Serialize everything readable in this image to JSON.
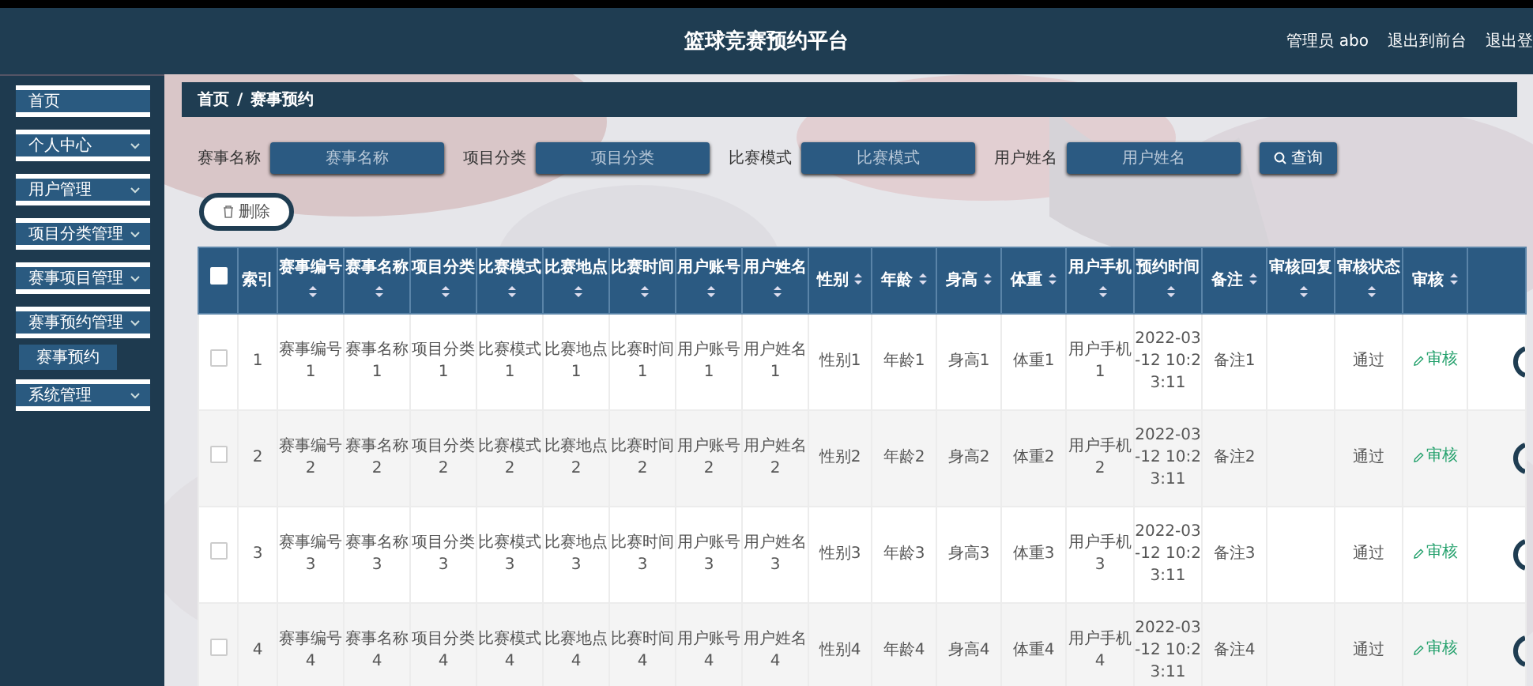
{
  "header": {
    "title": "篮球竞赛预约平台",
    "links": [
      "管理员 abo",
      "退出到前台",
      "退出登"
    ]
  },
  "sidebar": {
    "items": [
      {
        "label": "首页",
        "expandable": false
      },
      {
        "label": "个人中心",
        "expandable": true
      },
      {
        "label": "用户管理",
        "expandable": true
      },
      {
        "label": "项目分类管理",
        "expandable": true
      },
      {
        "label": "赛事项目管理",
        "expandable": true
      },
      {
        "label": "赛事预约管理",
        "expandable": true,
        "children": [
          {
            "label": "赛事预约",
            "selected": true
          }
        ]
      },
      {
        "label": "系统管理",
        "expandable": true
      }
    ]
  },
  "breadcrumb": [
    "首页",
    "/",
    "赛事预约"
  ],
  "search": {
    "fields": [
      {
        "label": "赛事名称",
        "placeholder": "赛事名称"
      },
      {
        "label": "项目分类",
        "placeholder": "项目分类"
      },
      {
        "label": "比赛模式",
        "placeholder": "比赛模式"
      },
      {
        "label": "用户姓名",
        "placeholder": "用户姓名"
      }
    ],
    "button": "查询"
  },
  "delete_button": "删除",
  "table": {
    "select_all_checked": false,
    "columns": [
      {
        "label": "索引",
        "sortable": false
      },
      {
        "label": "赛事编号",
        "sortable": true
      },
      {
        "label": "赛事名称",
        "sortable": true
      },
      {
        "label": "项目分类",
        "sortable": true
      },
      {
        "label": "比赛模式",
        "sortable": true
      },
      {
        "label": "比赛地点",
        "sortable": true
      },
      {
        "label": "比赛时间",
        "sortable": true
      },
      {
        "label": "用户账号",
        "sortable": true
      },
      {
        "label": "用户姓名",
        "sortable": true
      },
      {
        "label": "性别",
        "sortable": true
      },
      {
        "label": "年龄",
        "sortable": true
      },
      {
        "label": "身高",
        "sortable": true
      },
      {
        "label": "体重",
        "sortable": true
      },
      {
        "label": "用户手机",
        "sortable": true
      },
      {
        "label": "预约时间",
        "sortable": true
      },
      {
        "label": "备注",
        "sortable": true
      },
      {
        "label": "审核回复",
        "sortable": true
      },
      {
        "label": "审核状态",
        "sortable": true
      },
      {
        "label": "审核",
        "sortable": true,
        "kind": "link"
      }
    ],
    "rows": [
      {
        "checked": false,
        "cells": [
          "1",
          "赛事编号1",
          "赛事名称1",
          "项目分类1",
          "比赛模式1",
          "比赛地点1",
          "比赛时间1",
          "用户账号1",
          "用户姓名1",
          "性别1",
          "年龄1",
          "身高1",
          "体重1",
          "用户手机1",
          "2022-03-12 10:23:11",
          "备注1",
          "",
          "通过",
          "审核"
        ]
      },
      {
        "checked": false,
        "cells": [
          "2",
          "赛事编号2",
          "赛事名称2",
          "项目分类2",
          "比赛模式2",
          "比赛地点2",
          "比赛时间2",
          "用户账号2",
          "用户姓名2",
          "性别2",
          "年龄2",
          "身高2",
          "体重2",
          "用户手机2",
          "2022-03-12 10:23:11",
          "备注2",
          "",
          "通过",
          "审核"
        ]
      },
      {
        "checked": false,
        "cells": [
          "3",
          "赛事编号3",
          "赛事名称3",
          "项目分类3",
          "比赛模式3",
          "比赛地点3",
          "比赛时间3",
          "用户账号3",
          "用户姓名3",
          "性别3",
          "年龄3",
          "身高3",
          "体重3",
          "用户手机3",
          "2022-03-12 10:23:11",
          "备注3",
          "",
          "通过",
          "审核"
        ]
      },
      {
        "checked": false,
        "cells": [
          "4",
          "赛事编号4",
          "赛事名称4",
          "项目分类4",
          "比赛模式4",
          "比赛地点4",
          "比赛时间4",
          "用户账号4",
          "用户姓名4",
          "性别4",
          "年龄4",
          "身高4",
          "体重4",
          "用户手机4",
          "2022-03-12 10:23:11",
          "备注4",
          "",
          "通过",
          "审核"
        ]
      }
    ]
  }
}
